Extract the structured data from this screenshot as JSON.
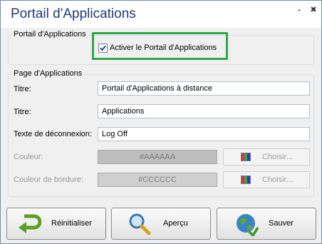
{
  "window": {
    "title": "Portail d'Applications",
    "minimize": "-",
    "close": "✖"
  },
  "portal_group": {
    "legend": "Portail d'Applications",
    "checkbox_label": "Activer le Portail d'Applications",
    "checked": true
  },
  "page_group": {
    "legend": "Page d'Applications",
    "fields": [
      {
        "label": "Titre:",
        "value": "Portail d'Applications à distance"
      },
      {
        "label": "Titre:",
        "value": "Applications"
      },
      {
        "label": "Texte de déconnexion:",
        "value": "Log Off"
      }
    ],
    "color": {
      "label": "Couleur:",
      "value": "#AAAAAA",
      "button": "Choisir..."
    },
    "border_color": {
      "label": "Couleur de bordure:",
      "value": "#CCCCCC",
      "button": "Choisir..."
    }
  },
  "buttons": {
    "reset": "Réinitialiser",
    "preview": "Aperçu",
    "save": "Sauver"
  },
  "colors": {
    "highlight": "#2fa847",
    "title": "#1f3d73"
  },
  "icons": [
    "checkbox-checked-icon",
    "palette-icon",
    "undo-arrow-icon",
    "magnifier-icon",
    "globe-save-icon"
  ]
}
